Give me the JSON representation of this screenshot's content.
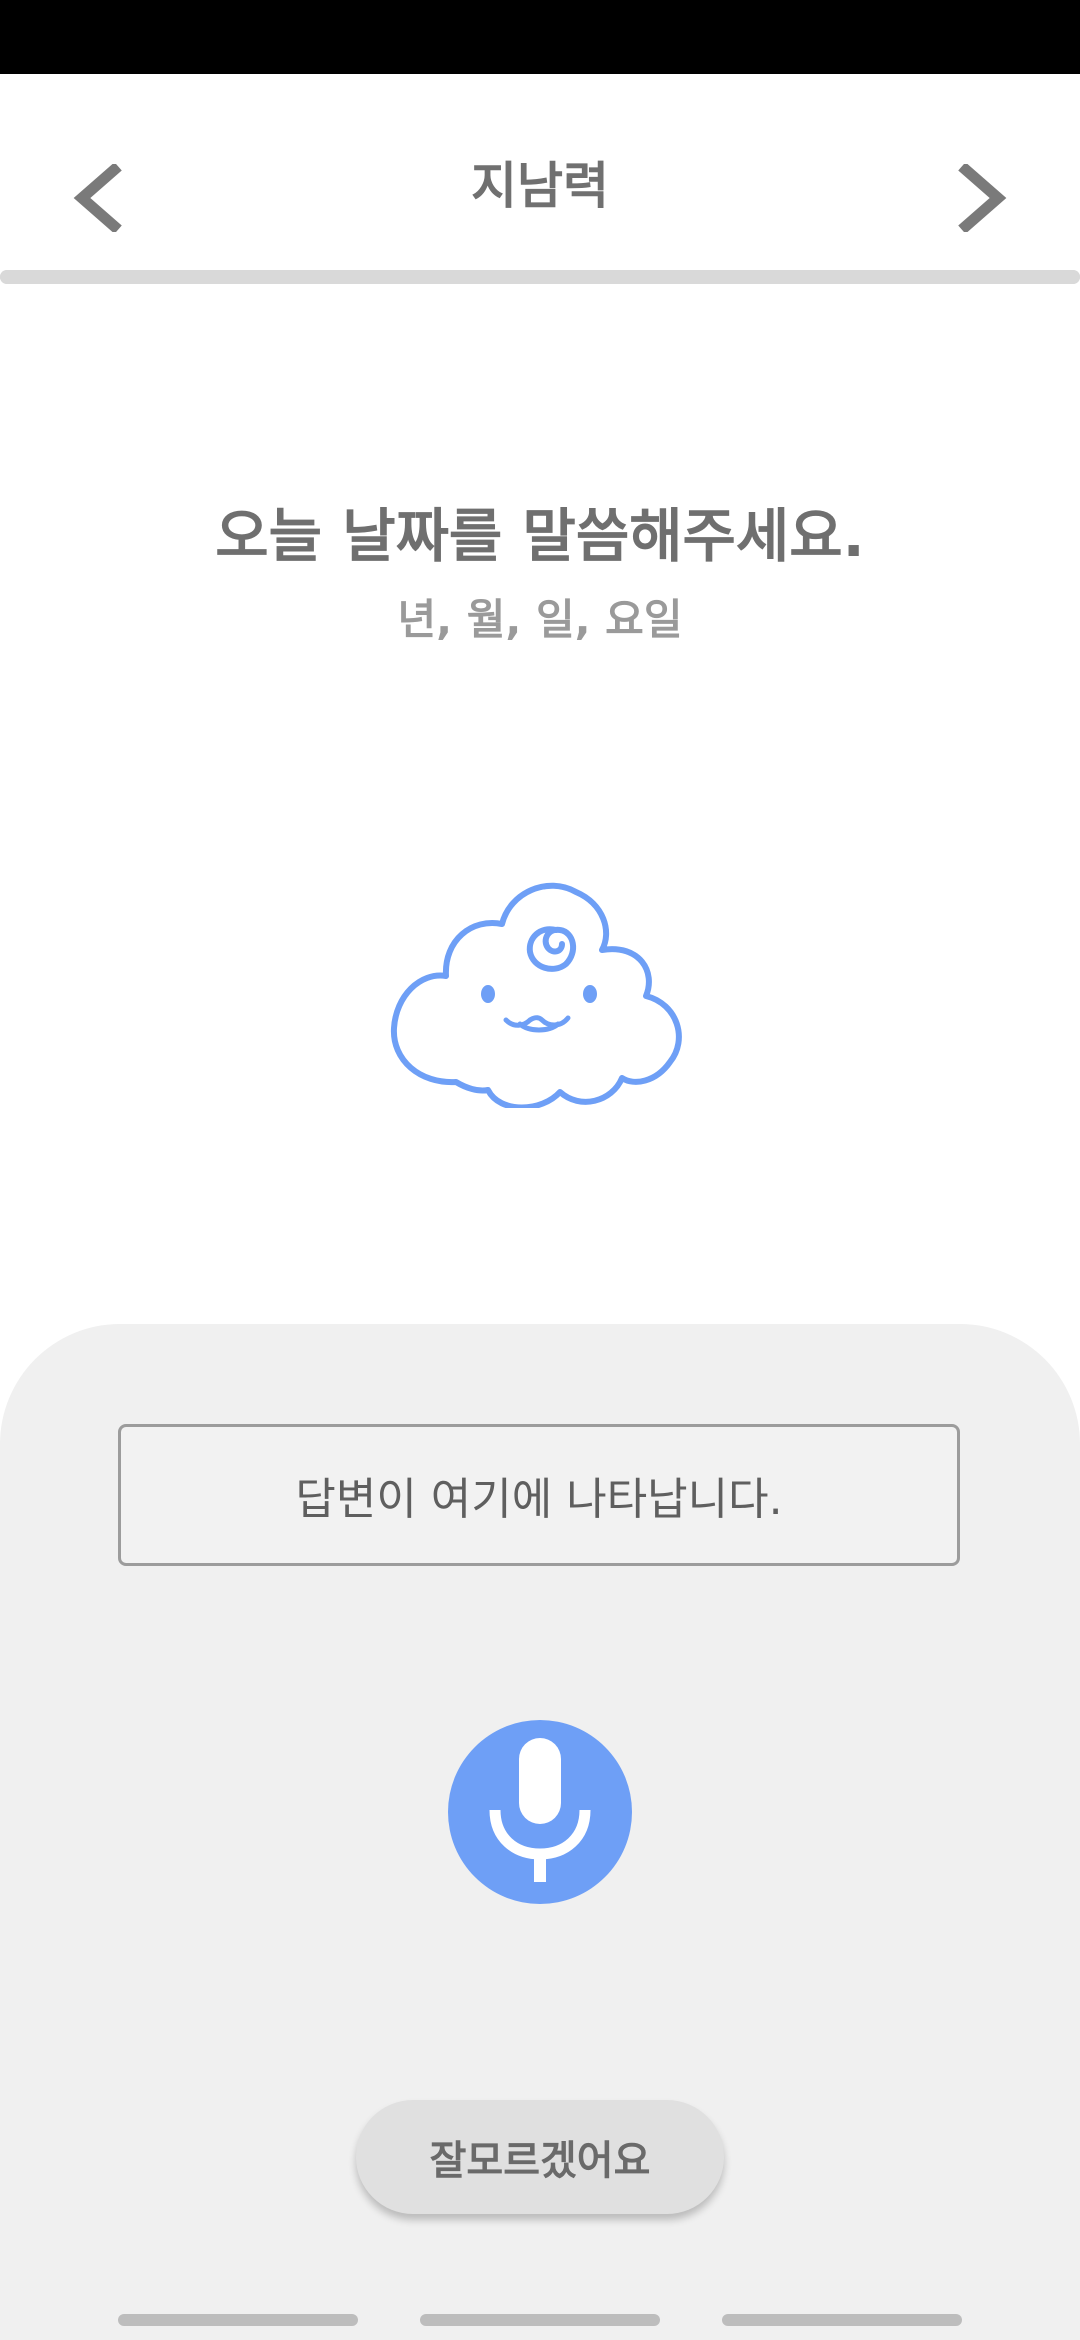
{
  "header": {
    "title": "지남력",
    "prev_icon": "chevron-left-icon",
    "next_icon": "chevron-right-icon",
    "progress": 1.0
  },
  "question": {
    "text": "오늘 날짜를 말씀해주세요.",
    "hint": "년, 월, 일, 요일"
  },
  "mascot": {
    "icon": "cloud-mascot-icon",
    "color": "#6e9ff6"
  },
  "answer": {
    "placeholder": "답변이 여기에 나타납니다."
  },
  "mic": {
    "icon": "microphone-icon",
    "color": "#6e9ff6"
  },
  "actions": {
    "dont_know_label": "잘모르겠어요"
  },
  "colors": {
    "accent": "#6e9ff6",
    "panel": "#f0f0f0",
    "text_primary": "#6f6f6f"
  }
}
